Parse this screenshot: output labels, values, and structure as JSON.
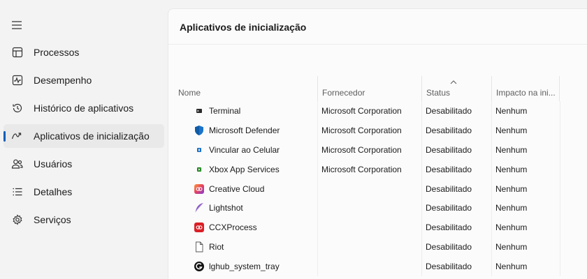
{
  "sidebar": {
    "menu_icon": "hamburger-icon",
    "items": [
      {
        "label": "Processos",
        "icon": "processes-grid-icon",
        "active": false
      },
      {
        "label": "Desempenho",
        "icon": "performance-pulse-icon",
        "active": false
      },
      {
        "label": "Histórico de aplicativos",
        "icon": "history-clock-icon",
        "active": false
      },
      {
        "label": "Aplicativos de inicialização",
        "icon": "startup-gauge-icon",
        "active": true
      },
      {
        "label": "Usuários",
        "icon": "users-icon",
        "active": false
      },
      {
        "label": "Detalhes",
        "icon": "details-list-icon",
        "active": false
      },
      {
        "label": "Serviços",
        "icon": "services-gear-icon",
        "active": false
      }
    ]
  },
  "main": {
    "title": "Aplicativos de inicialização",
    "columns": [
      "Nome",
      "Fornecedor",
      "Status",
      "Impacto na ini..."
    ],
    "sorted_column": "Status",
    "rows": [
      {
        "name": "Terminal",
        "vendor": "Microsoft Corporation",
        "status": "Desabilitado",
        "impact": "Nenhum",
        "icon": "terminal-icon"
      },
      {
        "name": "Microsoft Defender",
        "vendor": "Microsoft Corporation",
        "status": "Desabilitado",
        "impact": "Nenhum",
        "icon": "defender-shield-icon"
      },
      {
        "name": "Vincular ao Celular",
        "vendor": "Microsoft Corporation",
        "status": "Desabilitado",
        "impact": "Nenhum",
        "icon": "phone-link-icon"
      },
      {
        "name": "Xbox App Services",
        "vendor": "Microsoft Corporation",
        "status": "Desabilitado",
        "impact": "Nenhum",
        "icon": "xbox-icon"
      },
      {
        "name": "Creative Cloud",
        "vendor": "",
        "status": "Desabilitado",
        "impact": "Nenhum",
        "icon": "creative-cloud-icon"
      },
      {
        "name": "Lightshot",
        "vendor": "",
        "status": "Desabilitado",
        "impact": "Nenhum",
        "icon": "lightshot-feather-icon"
      },
      {
        "name": "CCXProcess",
        "vendor": "",
        "status": "Desabilitado",
        "impact": "Nenhum",
        "icon": "adobe-ccx-icon"
      },
      {
        "name": "Riot",
        "vendor": "",
        "status": "Desabilitado",
        "impact": "Nenhum",
        "icon": "blank-file-icon"
      },
      {
        "name": "lghub_system_tray",
        "vendor": "",
        "status": "Desabilitado",
        "impact": "Nenhum",
        "icon": "logitech-g-icon"
      }
    ]
  },
  "colors": {
    "accent": "#005fb8",
    "defender": "#1a73c9",
    "xbox": "#107c10",
    "creative_cloud": "#e4405f",
    "adobe_red": "#da1f26",
    "lightshot": "#8a5cc7"
  }
}
